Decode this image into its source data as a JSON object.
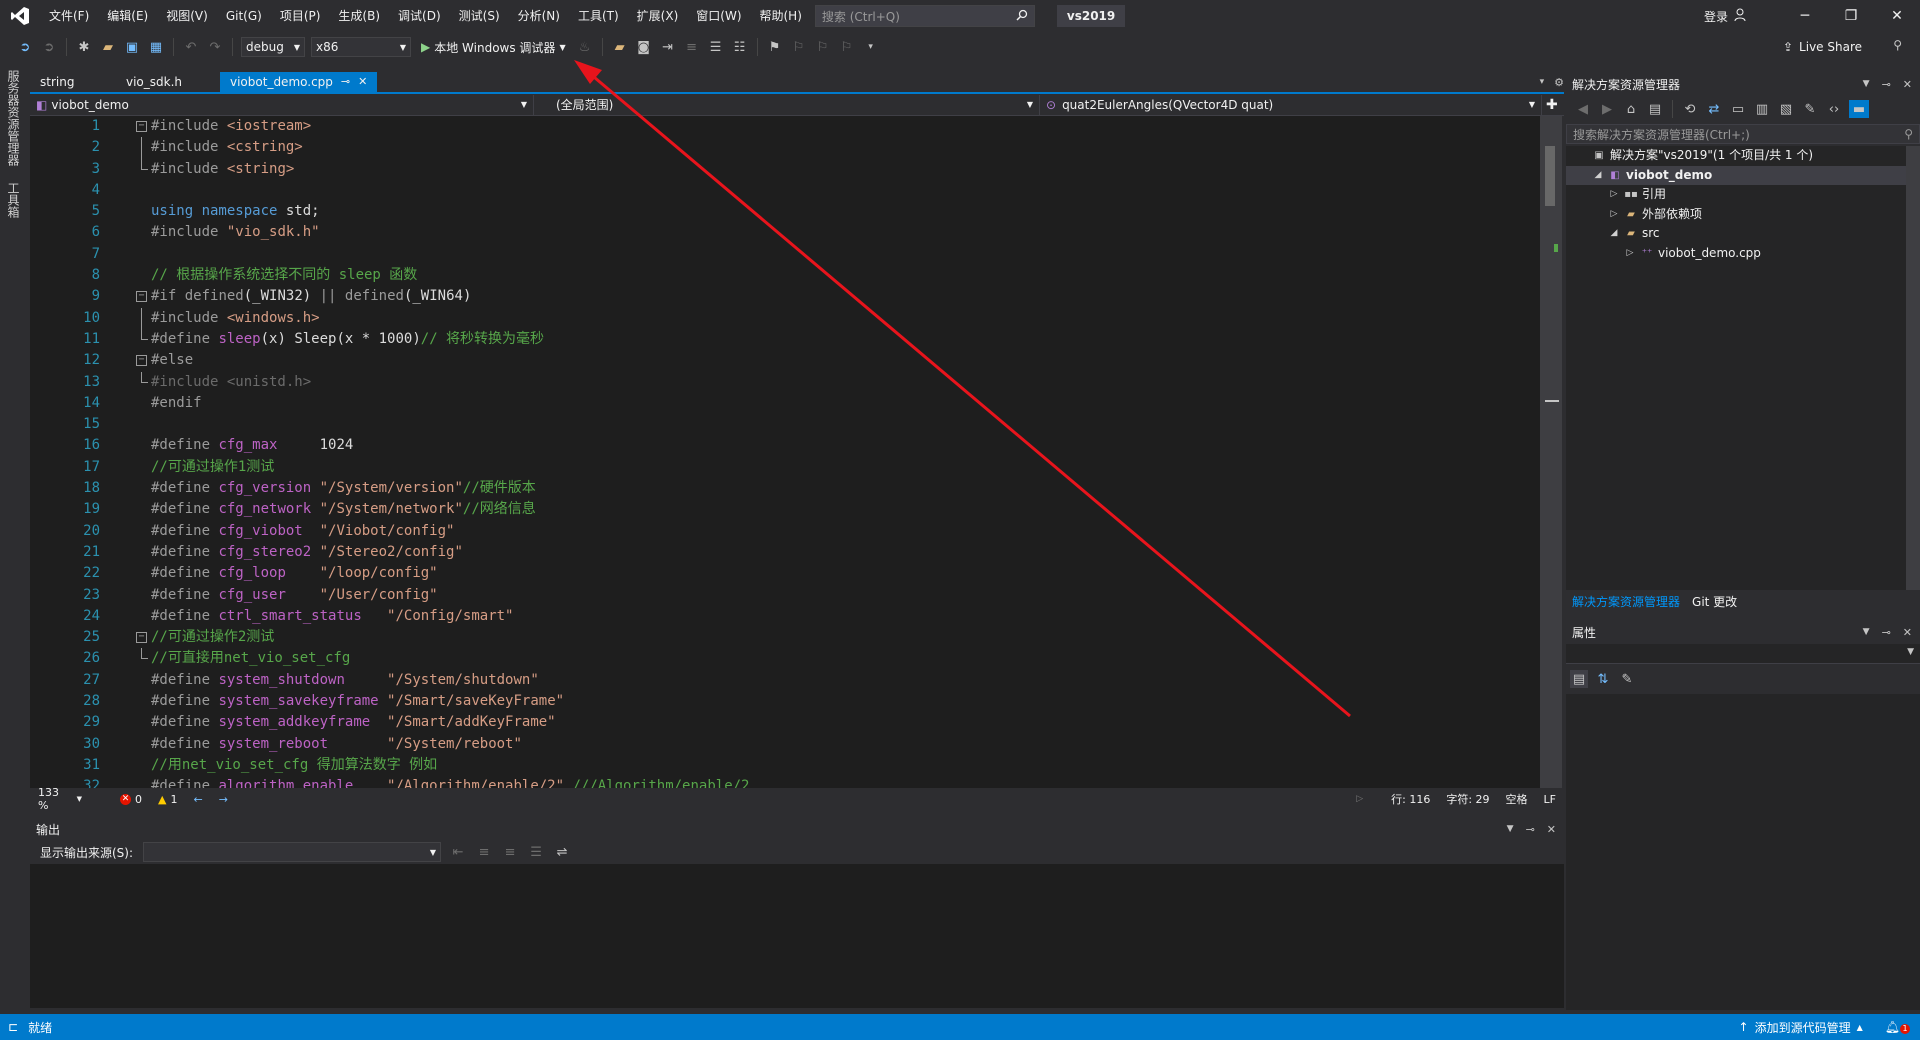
{
  "title_bar": {
    "menu": [
      "文件(F)",
      "编辑(E)",
      "视图(V)",
      "Git(G)",
      "项目(P)",
      "生成(B)",
      "调试(D)",
      "测试(S)",
      "分析(N)",
      "工具(T)",
      "扩展(X)",
      "窗口(W)",
      "帮助(H)"
    ],
    "search_placeholder": "搜索 (Ctrl+Q)",
    "solution_name": "vs2019",
    "login": "登录"
  },
  "toolbar": {
    "config": "debug",
    "platform": "x86",
    "run_label": "本地 Windows 调试器",
    "live_share": "Live Share"
  },
  "left_strip": {
    "items": [
      "服务器资源管理器",
      "工具箱"
    ]
  },
  "doc_tabs": [
    {
      "label": "string",
      "active": false
    },
    {
      "label": "vio_sdk.h",
      "active": false
    },
    {
      "label": "viobot_demo.cpp",
      "active": true
    }
  ],
  "nav_bar": {
    "project": "viobot_demo",
    "scope": "(全局范围)",
    "member": "quat2EulerAngles(QVector4D quat)"
  },
  "code_lines": [
    {
      "n": "1",
      "fold": "open",
      "html": "<span class=\"pp\">#include</span> <span class=\"str\">&lt;iostream&gt;</span>"
    },
    {
      "n": "2",
      "fold": "line",
      "html": "<span class=\"pp\">#include</span> <span class=\"str\">&lt;cstring&gt;</span>"
    },
    {
      "n": "3",
      "fold": "end",
      "html": "<span class=\"pp\">#include</span> <span class=\"str\">&lt;string&gt;</span>"
    },
    {
      "n": "4",
      "fold": "",
      "html": ""
    },
    {
      "n": "5",
      "fold": "",
      "html": "<span class=\"kw\">using namespace</span> <span class=\"plain\">std;</span>"
    },
    {
      "n": "6",
      "fold": "",
      "html": "<span class=\"pp\">#include</span> <span class=\"str\">\"vio_sdk.h\"</span>"
    },
    {
      "n": "7",
      "fold": "",
      "html": ""
    },
    {
      "n": "8",
      "fold": "",
      "html": "<span class=\"cm\">// 根据操作系统选择不同的 sleep 函数</span>"
    },
    {
      "n": "9",
      "fold": "open",
      "html": "<span class=\"pp\">#if</span> <span class=\"pp\">defined</span><span class=\"plain\">(_WIN32)</span> <span class=\"pp\">||</span> <span class=\"pp\">defined</span><span class=\"plain\">(_WIN64)</span>"
    },
    {
      "n": "10",
      "fold": "line",
      "html": "<span class=\"pp\">#include</span> <span class=\"str\">&lt;windows.h&gt;</span>"
    },
    {
      "n": "11",
      "fold": "end",
      "html": "<span class=\"pp\">#define</span> <span class=\"mac\">sleep</span><span class=\"plain\">(x) Sleep(x * 1000)</span><span class=\"cm\">// 将秒转换为毫秒</span>"
    },
    {
      "n": "12",
      "fold": "open",
      "html": "<span class=\"pp\">#else</span>"
    },
    {
      "n": "13",
      "fold": "end",
      "html": "<span class=\"dim\">#include &lt;unistd.h&gt;</span>"
    },
    {
      "n": "14",
      "fold": "",
      "html": "<span class=\"pp\">#endif</span>"
    },
    {
      "n": "15",
      "fold": "",
      "html": ""
    },
    {
      "n": "16",
      "fold": "",
      "html": "<span class=\"pp\">#define</span> <span class=\"mac\">cfg_max</span>     <span class=\"plain\">1024</span>"
    },
    {
      "n": "17",
      "fold": "",
      "html": "<span class=\"cm\">//可通过操作1测试</span>"
    },
    {
      "n": "18",
      "fold": "",
      "html": "<span class=\"pp\">#define</span> <span class=\"mac\">cfg_version</span> <span class=\"str\">\"/System/version\"</span><span class=\"cm\">//硬件版本</span>"
    },
    {
      "n": "19",
      "fold": "",
      "html": "<span class=\"pp\">#define</span> <span class=\"mac\">cfg_network</span> <span class=\"str\">\"/System/network\"</span><span class=\"cm\">//网络信息</span>"
    },
    {
      "n": "20",
      "fold": "",
      "html": "<span class=\"pp\">#define</span> <span class=\"mac\">cfg_viobot</span>  <span class=\"str\">\"/Viobot/config\"</span>"
    },
    {
      "n": "21",
      "fold": "",
      "html": "<span class=\"pp\">#define</span> <span class=\"mac\">cfg_stereo2</span> <span class=\"str\">\"/Stereo2/config\"</span>"
    },
    {
      "n": "22",
      "fold": "",
      "html": "<span class=\"pp\">#define</span> <span class=\"mac\">cfg_loop</span>    <span class=\"str\">\"/loop/config\"</span>"
    },
    {
      "n": "23",
      "fold": "",
      "html": "<span class=\"pp\">#define</span> <span class=\"mac\">cfg_user</span>    <span class=\"str\">\"/User/config\"</span>"
    },
    {
      "n": "24",
      "fold": "",
      "html": "<span class=\"pp\">#define</span> <span class=\"mac\">ctrl_smart_status</span>   <span class=\"str\">\"/Config/smart\"</span>"
    },
    {
      "n": "25",
      "fold": "open",
      "html": "<span class=\"cm\">//可通过操作2测试</span>"
    },
    {
      "n": "26",
      "fold": "end",
      "html": "<span class=\"cm\">//可直接用net_vio_set_cfg</span>"
    },
    {
      "n": "27",
      "fold": "",
      "html": "<span class=\"pp\">#define</span> <span class=\"mac\">system_shutdown</span>     <span class=\"str\">\"/System/shutdown\"</span>"
    },
    {
      "n": "28",
      "fold": "",
      "html": "<span class=\"pp\">#define</span> <span class=\"mac\">system_savekeyframe</span> <span class=\"str\">\"/Smart/saveKeyFrame\"</span>"
    },
    {
      "n": "29",
      "fold": "",
      "html": "<span class=\"pp\">#define</span> <span class=\"mac\">system_addkeyframe</span>  <span class=\"str\">\"/Smart/addKeyFrame\"</span>"
    },
    {
      "n": "30",
      "fold": "",
      "html": "<span class=\"pp\">#define</span> <span class=\"mac\">system_reboot</span>       <span class=\"str\">\"/System/reboot\"</span>"
    },
    {
      "n": "31",
      "fold": "",
      "html": "<span class=\"cm\">//用net_vio_set_cfg 得加算法数字 例如</span>"
    },
    {
      "n": "32",
      "fold": "",
      "html": "<span class=\"pp\">#define</span> <span class=\"mac\">algorithm_enable</span>    <span class=\"str\">\"/Algorithm/enable/2\"</span> <span class=\"cm\">///Algorithm/enable/2</span>"
    }
  ],
  "editor_status": {
    "zoom": "133 %",
    "errors": "0",
    "warnings": "1",
    "line": "行: 116",
    "char": "字符: 29",
    "spaces": "空格",
    "eol": "LF"
  },
  "output": {
    "title": "输出",
    "source_label": "显示输出来源(S):"
  },
  "solution_explorer": {
    "title": "解决方案资源管理器",
    "search_placeholder": "搜索解决方案资源管理器(Ctrl+;)",
    "tree": [
      {
        "label": "解决方案\"vs2019\"(1 个项目/共 1 个)",
        "indent": 0,
        "arrow": "",
        "icon": "solution-icon",
        "selected": false
      },
      {
        "label": "viobot_demo",
        "indent": 1,
        "arrow": "◢",
        "icon": "project-icon",
        "selected": true
      },
      {
        "label": "引用",
        "indent": 2,
        "arrow": "▷",
        "icon": "references-icon",
        "selected": false
      },
      {
        "label": "外部依赖项",
        "indent": 2,
        "arrow": "▷",
        "icon": "external-deps-icon",
        "selected": false
      },
      {
        "label": "src",
        "indent": 2,
        "arrow": "◢",
        "icon": "folder-icon",
        "selected": false
      },
      {
        "label": "viobot_demo.cpp",
        "indent": 3,
        "arrow": "▷",
        "icon": "cpp-file-icon",
        "selected": false
      }
    ],
    "tabs": [
      "解决方案资源管理器",
      "Git 更改"
    ]
  },
  "properties": {
    "title": "属性"
  },
  "statusbar": {
    "ready": "就绪",
    "source_control": "添加到源代码管理",
    "notifications": "1"
  },
  "colors": {
    "accent": "#007acc",
    "annotation_arrow": "#e8141c"
  }
}
